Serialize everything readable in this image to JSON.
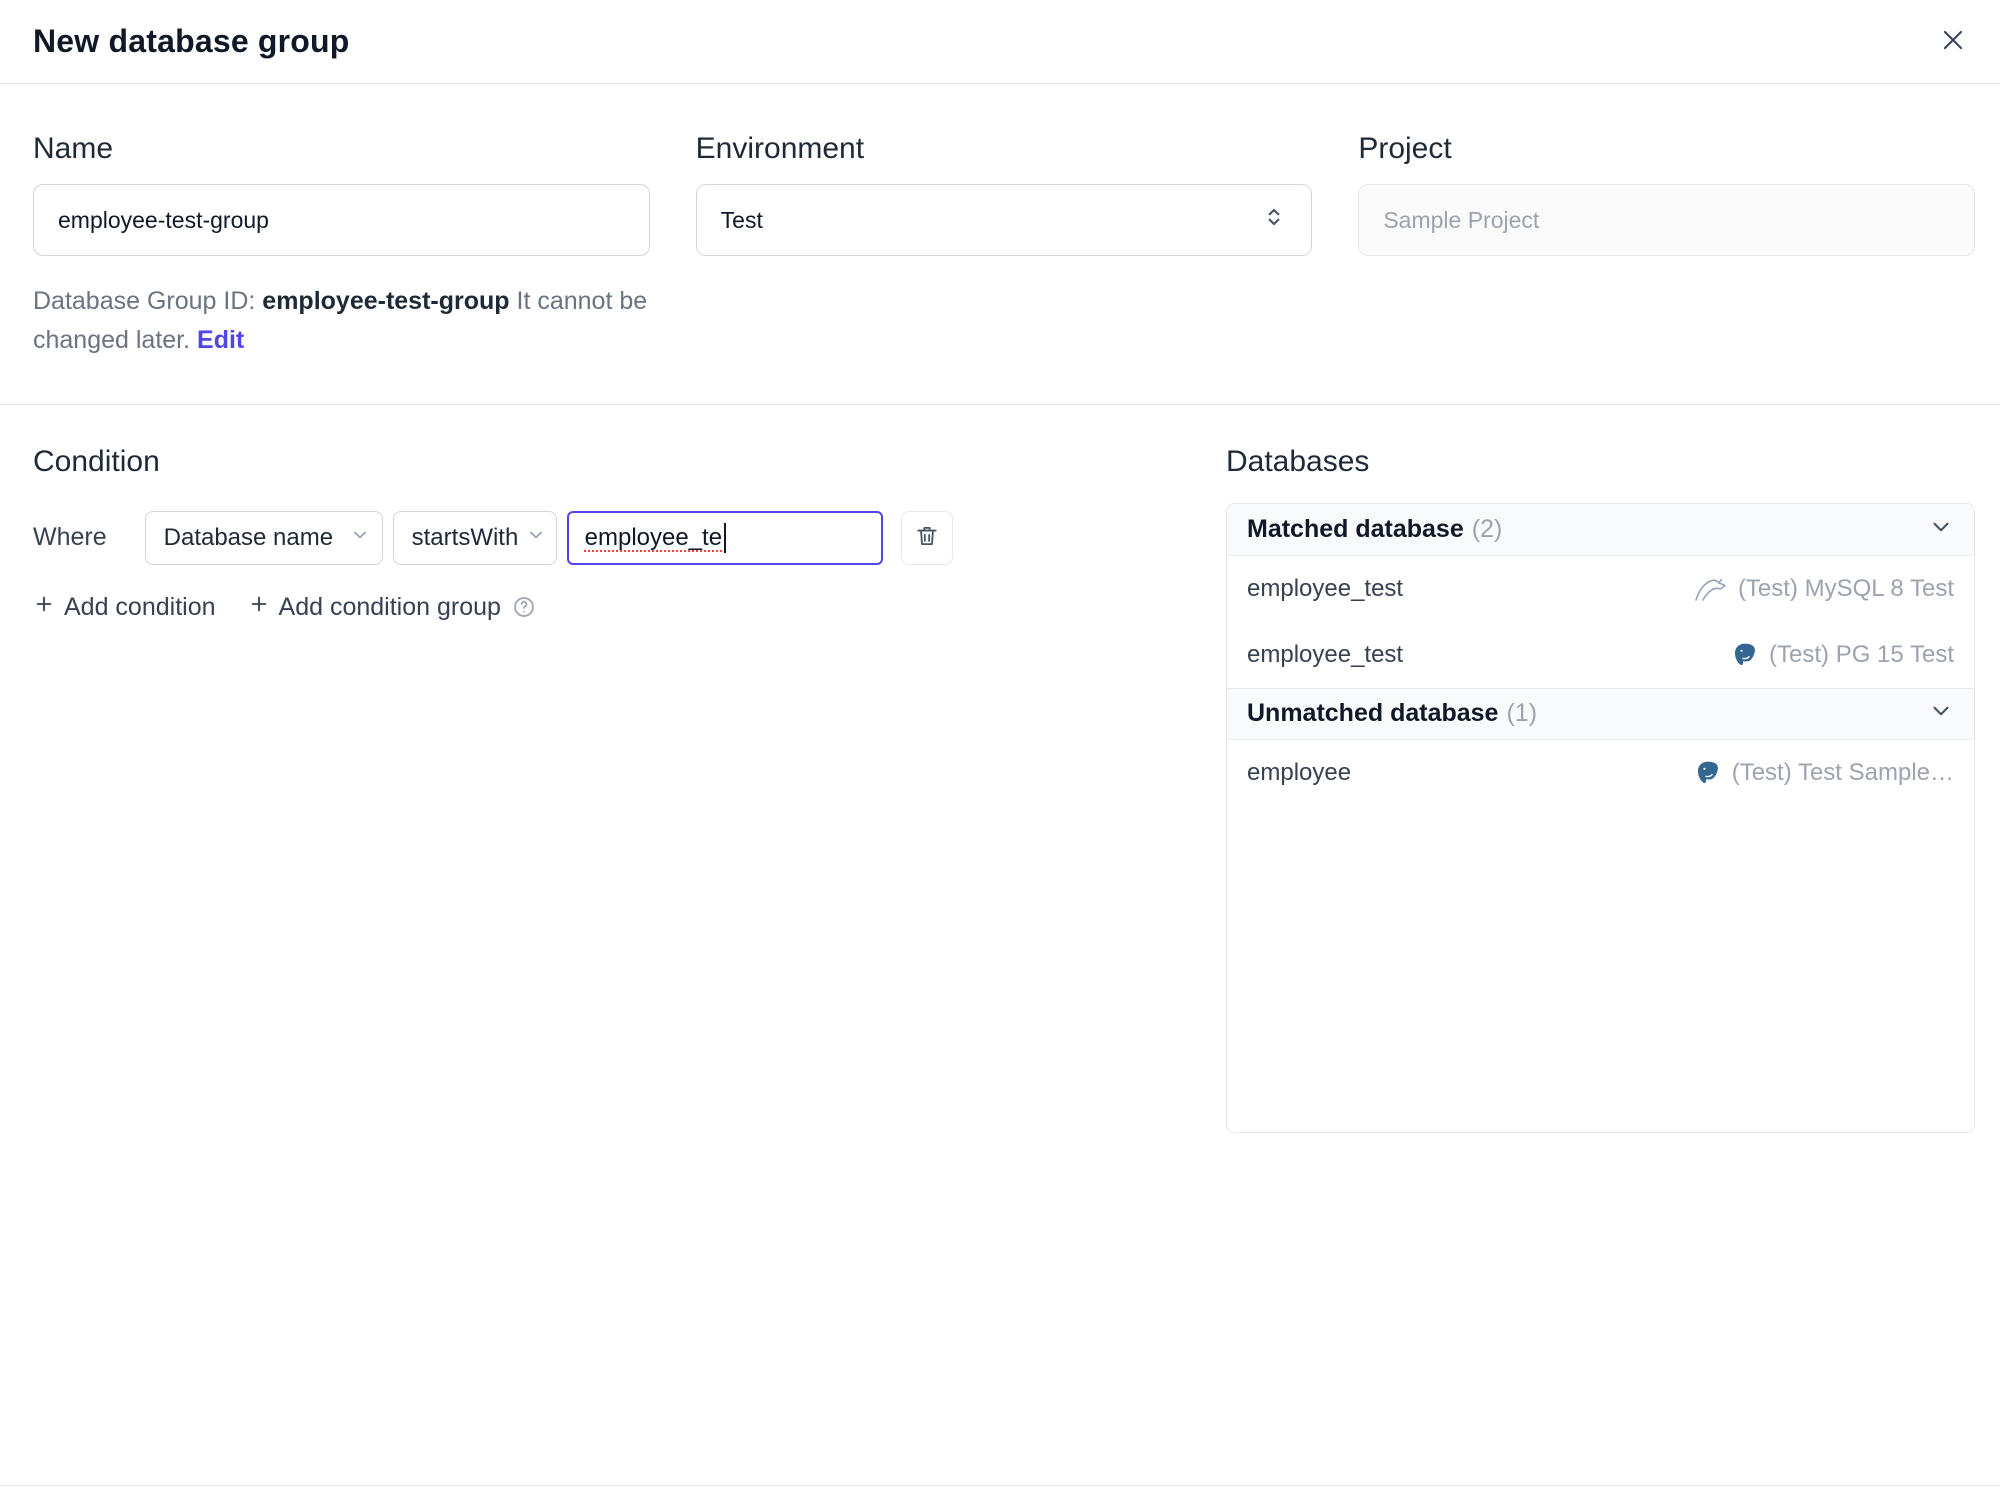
{
  "dialog": {
    "title": "New database group"
  },
  "form": {
    "name": {
      "label": "Name",
      "value": "employee-test-group"
    },
    "environment": {
      "label": "Environment",
      "value": "Test"
    },
    "project": {
      "label": "Project",
      "value": "Sample Project"
    },
    "group_id": {
      "prefix": "Database Group ID: ",
      "value": "employee-test-group",
      "suffix": " It cannot be changed later. ",
      "edit": "Edit"
    }
  },
  "condition": {
    "heading": "Condition",
    "where": "Where",
    "field": "Database name",
    "operator": "startsWith",
    "value": "employee_te",
    "add_condition": "Add condition",
    "add_condition_group": "Add condition group"
  },
  "databases": {
    "heading": "Databases",
    "matched": {
      "title": "Matched database",
      "count": "(2)"
    },
    "unmatched": {
      "title": "Unmatched database",
      "count": "(1)"
    },
    "rows": {
      "matched": [
        {
          "name": "employee_test",
          "engine": "mysql",
          "instance": "(Test) MySQL 8 Test"
        },
        {
          "name": "employee_test",
          "engine": "postgres",
          "instance": "(Test) PG 15 Test"
        }
      ],
      "unmatched": [
        {
          "name": "employee",
          "engine": "postgres",
          "instance": "(Test) Test Sample…"
        }
      ]
    }
  },
  "icons": {
    "close": "x-cross",
    "environment_select": "up-down-chevrons",
    "select_caret": "chevron-down",
    "delete_condition": "trash-can",
    "help": "question-circle",
    "add": "plus",
    "mysql": "dolphin",
    "postgres": "elephant"
  },
  "colors": {
    "accent": "#4f46e5",
    "focus_border": "#4f46e5",
    "border": "#e5e7eb",
    "muted_text": "#9ca3af",
    "header_bg": "#f9fafb"
  }
}
